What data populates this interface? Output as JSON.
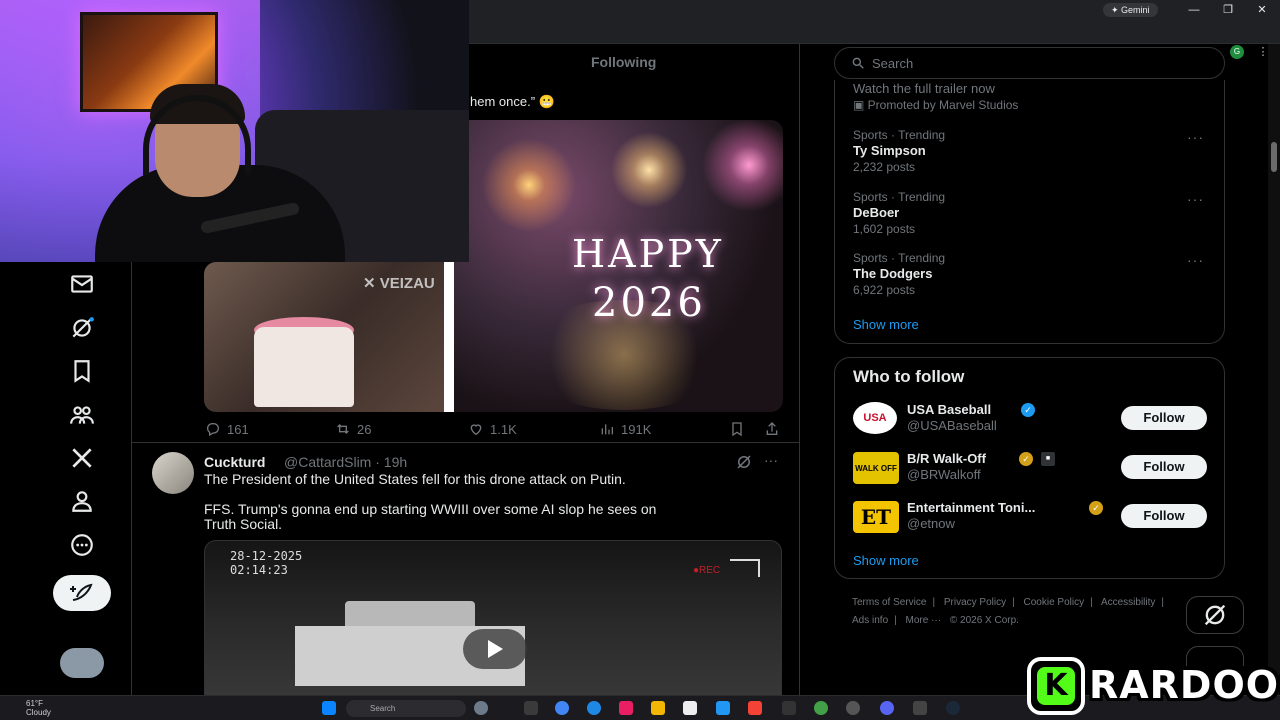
{
  "browser": {
    "gemini_label": "✦ Gemini",
    "window_controls": [
      "—",
      "❐",
      "✕"
    ]
  },
  "timeline": {
    "tab_following": "Following",
    "quoted_text": "hem once.” 😬",
    "media_watermark": "✕ VEIZAU",
    "media_text_happy": "HAPPY",
    "media_text_year": "2026",
    "tweet1_actions": {
      "replies": "161",
      "reposts": "26",
      "likes": "1.1K",
      "views": "191K"
    },
    "tweet2": {
      "name": "Cuckturd",
      "handle": "@CattardSlim · 19h",
      "line1": "The President of the United States fell for this drone attack on Putin.",
      "line2": "FFS. Trump's gonna end up starting WWIII over some AI slop he sees on",
      "line3": "Truth Social.",
      "video_date": "28-12-2025",
      "video_time": "02:14:23",
      "video_rec": "●REC"
    }
  },
  "sidebar": {
    "search_placeholder": "Search",
    "promo": {
      "title": "Watch the full trailer now",
      "subtitle": "Promoted by Marvel Studios"
    },
    "trends": [
      {
        "meta": "Sports · Trending",
        "name": "Ty Simpson",
        "count": "2,232 posts"
      },
      {
        "meta": "Sports · Trending",
        "name": "DeBoer",
        "count": "1,602 posts"
      },
      {
        "meta": "Sports · Trending",
        "name": "The Dodgers",
        "count": "6,922 posts"
      }
    ],
    "trends_show_more": "Show more",
    "who_to_follow": {
      "title": "Who to follow",
      "accounts": [
        {
          "name": "USA Baseball",
          "handle": "@USABaseball",
          "avatar": "USA",
          "follow": "Follow"
        },
        {
          "name": "B/R Walk-Off",
          "handle": "@BRWalkoff",
          "avatar": "WALK OFF",
          "follow": "Follow"
        },
        {
          "name": "Entertainment Toni...",
          "handle": "@etnow",
          "avatar": "ET",
          "follow": "Follow"
        }
      ],
      "show_more": "Show more"
    },
    "footer": [
      "Terms of Service",
      "|",
      "Privacy Policy",
      "|",
      "Cookie Policy",
      "|",
      "Accessibility",
      "|",
      "Ads info",
      "|",
      "More ···",
      "© 2026 X Corp."
    ]
  },
  "taskbar": {
    "weather_temp": "61°F",
    "weather_desc": "Cloudy",
    "search_label": "Search"
  },
  "overlay": {
    "logo_letter": "K",
    "logo_text": "RARDOOO"
  },
  "colors": {
    "accent_blue": "#1d9bf0",
    "kick_green": "#53fc18"
  }
}
